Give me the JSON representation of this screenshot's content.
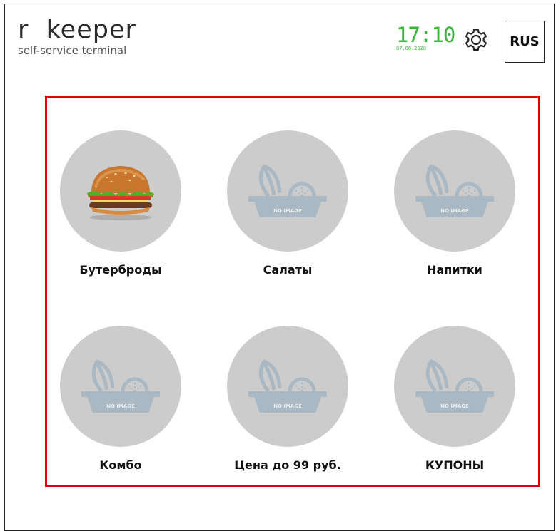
{
  "header": {
    "logo_title": "r  keeper",
    "logo_subtitle": "self-service terminal",
    "time": "17:10",
    "date": "07.08.2020",
    "language": "RUS",
    "settings_icon": "gear-icon"
  },
  "categories": [
    {
      "label": "Бутерброды",
      "image": "burger-image"
    },
    {
      "label": "Салаты",
      "image": "no-image-placeholder"
    },
    {
      "label": "Напитки",
      "image": "no-image-placeholder"
    },
    {
      "label": "Комбо",
      "image": "no-image-placeholder"
    },
    {
      "label": "Цена до 99 руб.",
      "image": "no-image-placeholder"
    },
    {
      "label": "КУПОНЫ",
      "image": "no-image-placeholder"
    }
  ],
  "placeholder_text": "NO IMAGE",
  "colors": {
    "time_green": "#3cb53c",
    "frame_red": "#e00000",
    "circle_gray": "#cccccc",
    "placeholder_blue_gray": "#a9b8c2"
  }
}
